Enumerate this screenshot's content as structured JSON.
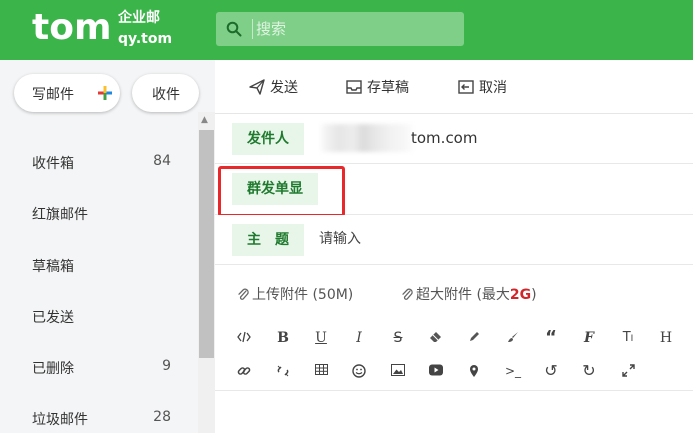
{
  "header": {
    "logo_main": "tom",
    "logo_sub1": "企业邮",
    "logo_sub2": "qy.tom",
    "search_placeholder": "搜索"
  },
  "sidebar": {
    "write_label": "写邮件",
    "receive_label": "收件",
    "folders": [
      {
        "name": "收件箱",
        "count": "84"
      },
      {
        "name": "红旗邮件",
        "count": ""
      },
      {
        "name": "草稿箱",
        "count": ""
      },
      {
        "name": "已发送",
        "count": ""
      },
      {
        "name": "已删除",
        "count": "9"
      },
      {
        "name": "垃圾邮件",
        "count": "28"
      }
    ]
  },
  "toolbar": {
    "send_label": "发送",
    "draft_label": "存草稿",
    "cancel_label": "取消"
  },
  "form": {
    "sender_label": "发件人",
    "sender_domain": "tom.com",
    "group_label": "群发单显",
    "subject_label": "主　题",
    "subject_placeholder": "请输入"
  },
  "attachments": {
    "upload_label": "上传附件",
    "upload_limit": "(50M)",
    "large_label": "超大附件",
    "large_prefix": "(最大",
    "large_size": "2G",
    "large_suffix": ")"
  },
  "editor_tools": {
    "row1": [
      "source-code-icon",
      "bold-icon",
      "underline-icon",
      "italic-icon",
      "strikethrough-icon",
      "eraser-icon",
      "pencil-icon",
      "brush-icon",
      "quote-icon",
      "font-icon",
      "text-size-icon",
      "heading-icon"
    ],
    "row2": [
      "link-icon",
      "unlink-icon",
      "table-icon",
      "emoji-icon",
      "image-icon",
      "video-icon",
      "location-icon",
      "code-icon",
      "undo-icon",
      "redo-icon",
      "fullscreen-icon"
    ]
  },
  "colors": {
    "brand_green": "#3bb54a",
    "tag_bg": "#e8f6ea",
    "tag_text": "#1f7a2e",
    "highlight_red": "#e8282b",
    "accent_red": "#d0262b"
  }
}
